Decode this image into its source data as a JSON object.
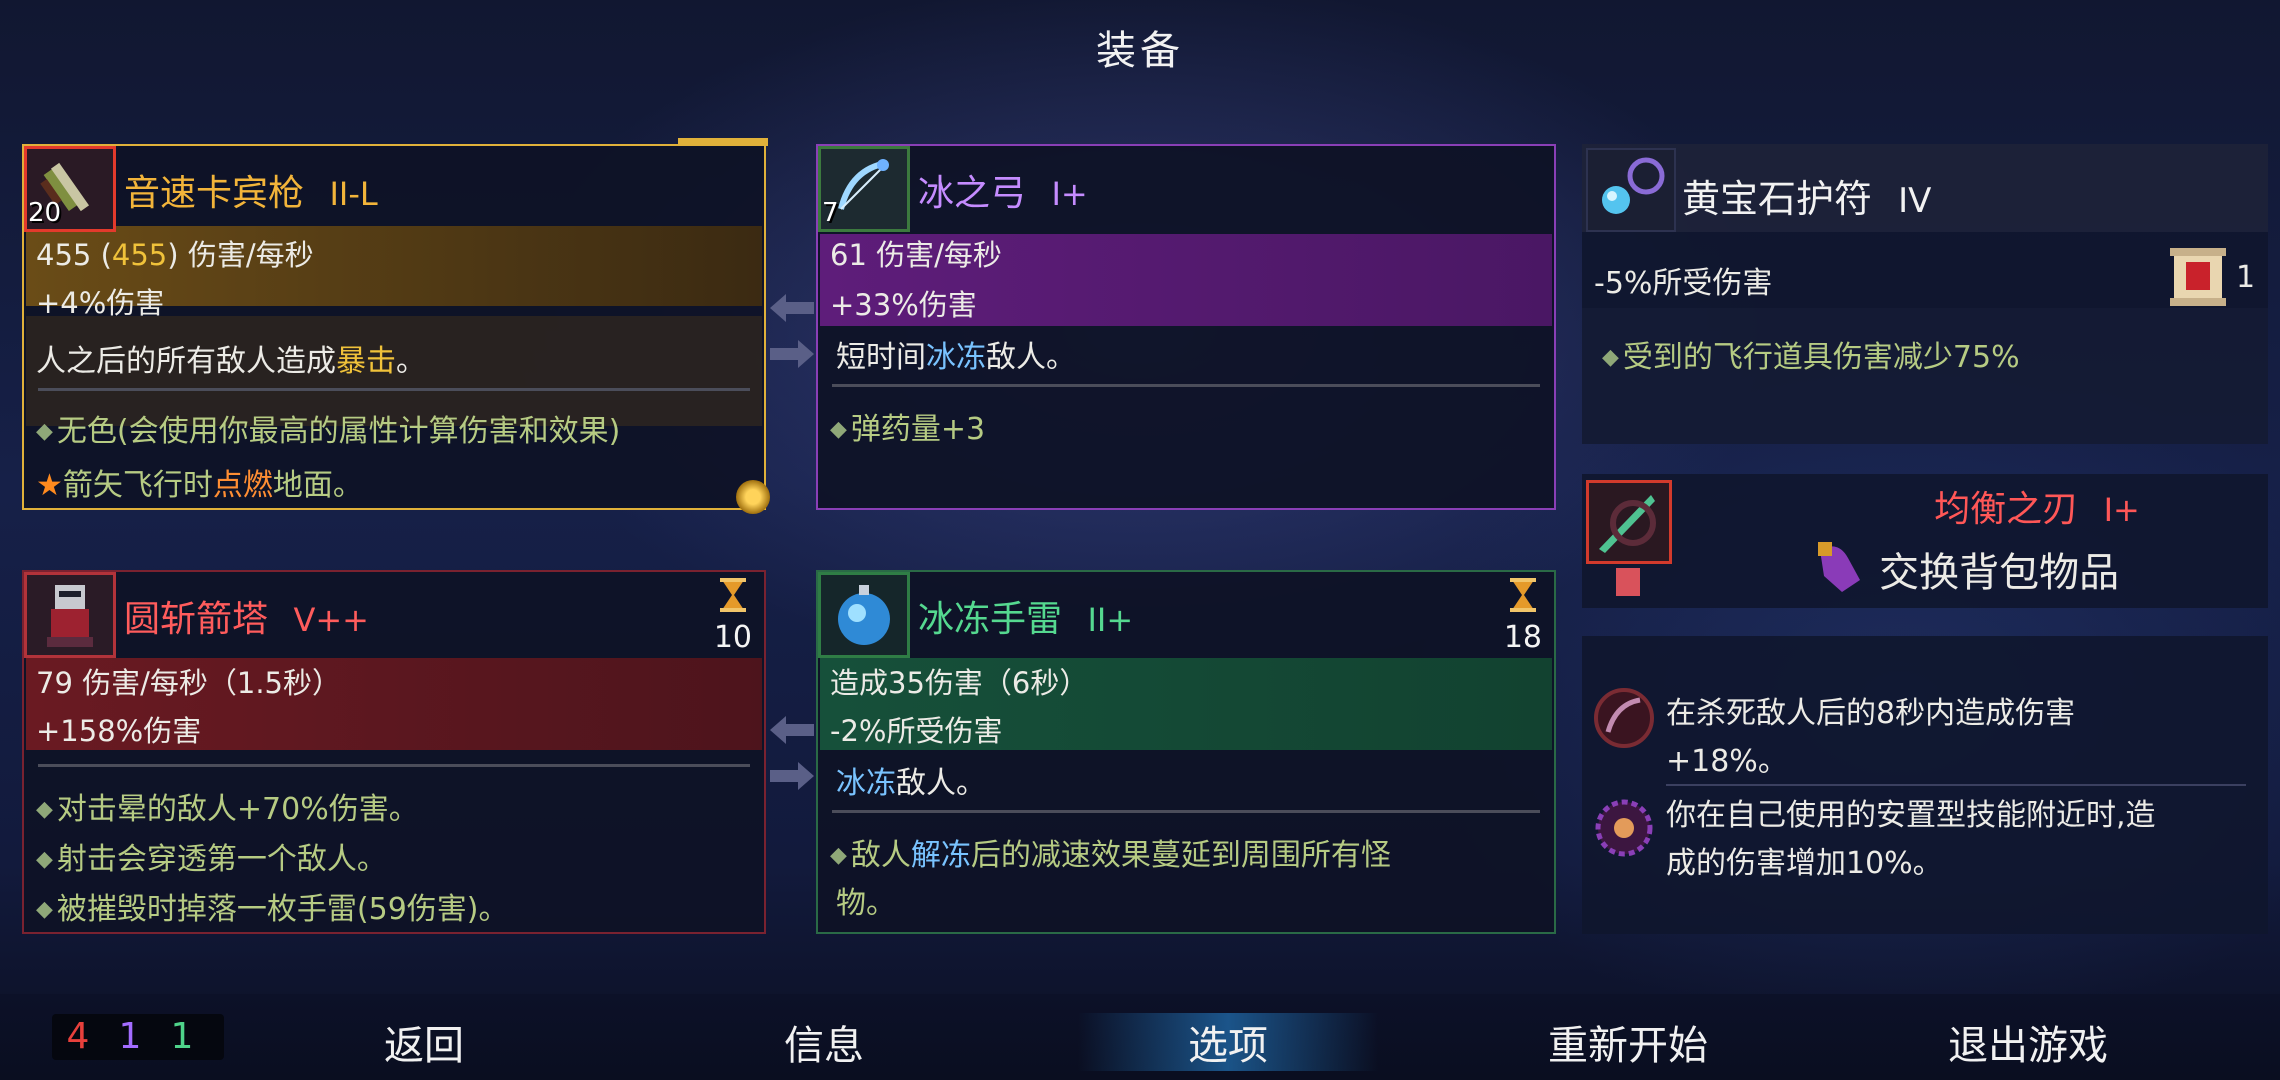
{
  "title": "装备",
  "weapons": {
    "primary": {
      "name": "音速卡宾枪",
      "tier": "II-L",
      "level": "20",
      "dps_value": "455",
      "dps_bonus": "455",
      "dps_label": "伤害/每秒",
      "bonus_line": "+4%伤害",
      "desc_prefix": "人之后的所有敌人造成",
      "desc_crit": "暴击",
      "desc_end": "。",
      "affix1": "无色(会使用你最高的属性计算伤害和效果)",
      "affix2_star": "★",
      "affix2_a": "箭矢飞行时",
      "affix2_burn": "点燃",
      "affix2_b": "地面。"
    },
    "secondary": {
      "name": "冰之弓",
      "tier": "I+",
      "level": "7",
      "dps_line": "61 伤害/每秒",
      "bonus_line": "+33%伤害",
      "desc_a": "短时间",
      "desc_freeze": "冰冻",
      "desc_b": "敌人。",
      "affix1": "弹药量+3"
    }
  },
  "skills": {
    "left": {
      "name": "圆斩箭塔",
      "tier": "V++",
      "cooldown": "10",
      "dps_line": "79 伤害/每秒（1.5秒）",
      "bonus_line": "+158%伤害",
      "affix1": "对击晕的敌人+70%伤害。",
      "affix2": "射击会穿透第一个敌人。",
      "affix3": "被摧毁时掉落一枚手雷(59伤害)。"
    },
    "right": {
      "name": "冰冻手雷",
      "tier": "II+",
      "cooldown": "18",
      "dmg_line": "造成35伤害（6秒）",
      "bonus_line": "-2%所受伤害",
      "desc_freeze": "冰冻",
      "desc_b": "敌人。",
      "affix1_a": "敌人",
      "affix1_thaw": "解冻",
      "affix1_b": "后的减速效果蔓延到周围所有怪",
      "affix1_c": "物。"
    }
  },
  "amulet": {
    "name": "黄宝石护符",
    "tier": "IV",
    "stat": "-5%所受伤害",
    "scroll_count": "1",
    "affix1": "受到的飞行道具伤害减少75%"
  },
  "backpack": {
    "name": "均衡之刃",
    "tier": "I+",
    "swap_label": "交换背包物品"
  },
  "mutations": [
    {
      "line1": "在杀死敌人后的8秒内造成伤害",
      "line2": "+18%。"
    },
    {
      "line1": "你在自己使用的安置型技能附近时,造",
      "line2": "成的伤害增加10%。"
    }
  ],
  "scores": {
    "red": "4",
    "purple": "1",
    "green": "1"
  },
  "colors": {
    "red": "#e8403c",
    "purple": "#a36cff",
    "green": "#4fd38a",
    "gold": "#f5c43a"
  },
  "nav": [
    {
      "label": "返回"
    },
    {
      "label": "信息"
    },
    {
      "label": "选项",
      "selected": true
    },
    {
      "label": "重新开始"
    },
    {
      "label": "退出游戏"
    }
  ]
}
